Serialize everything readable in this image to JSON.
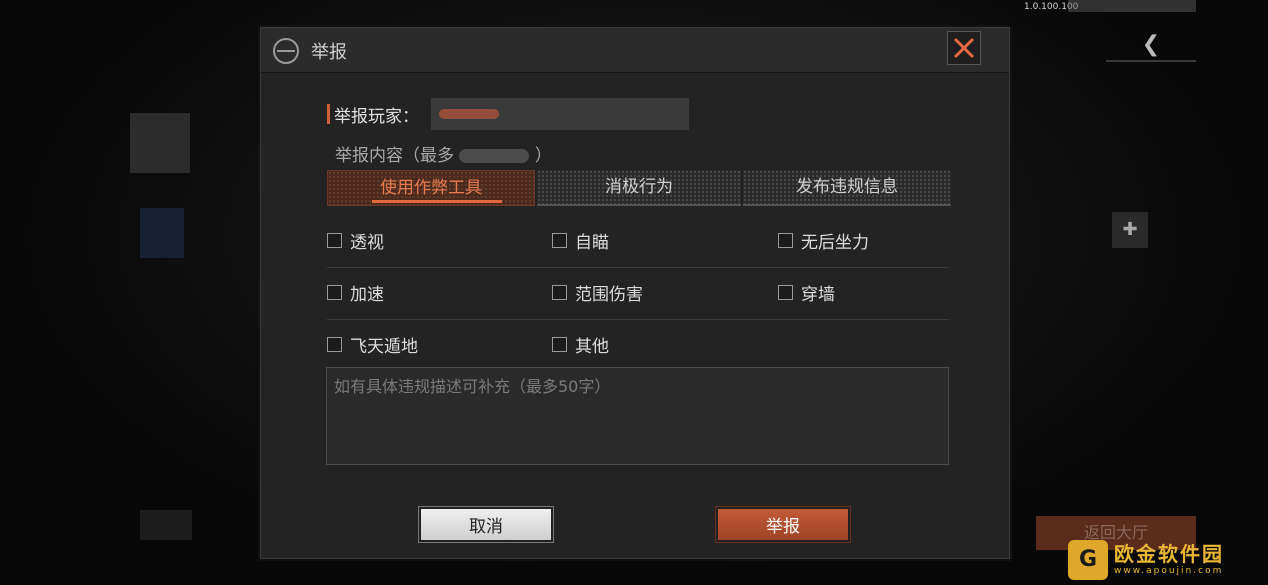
{
  "background": {
    "version": "1.0.100.100",
    "lobby_button": "返回大厅"
  },
  "watermark": {
    "title": "欧金软件园",
    "url": "www.apoujin.com",
    "logo_glyph": "G"
  },
  "dialog": {
    "title": "举报",
    "reporter_label": "举报玩家：",
    "player_name": "",
    "content_label_prefix": "举报内容（最多",
    "content_label_suffix": "）",
    "tabs": [
      {
        "label": "使用作弊工具",
        "active": true
      },
      {
        "label": "消极行为",
        "active": false
      },
      {
        "label": "发布违规信息",
        "active": false
      }
    ],
    "options": [
      [
        "透视",
        "自瞄",
        "无后坐力"
      ],
      [
        "加速",
        "范围伤害",
        "穿墙"
      ],
      [
        "飞天遁地",
        "其他"
      ]
    ],
    "description_placeholder": "如有具体违规描述可补充（最多50字）",
    "cancel_label": "取消",
    "submit_label": "举报"
  },
  "colors": {
    "accent": "#e06a3c",
    "submit_bg": "#b0502f",
    "dialog_bg": "#232323"
  }
}
